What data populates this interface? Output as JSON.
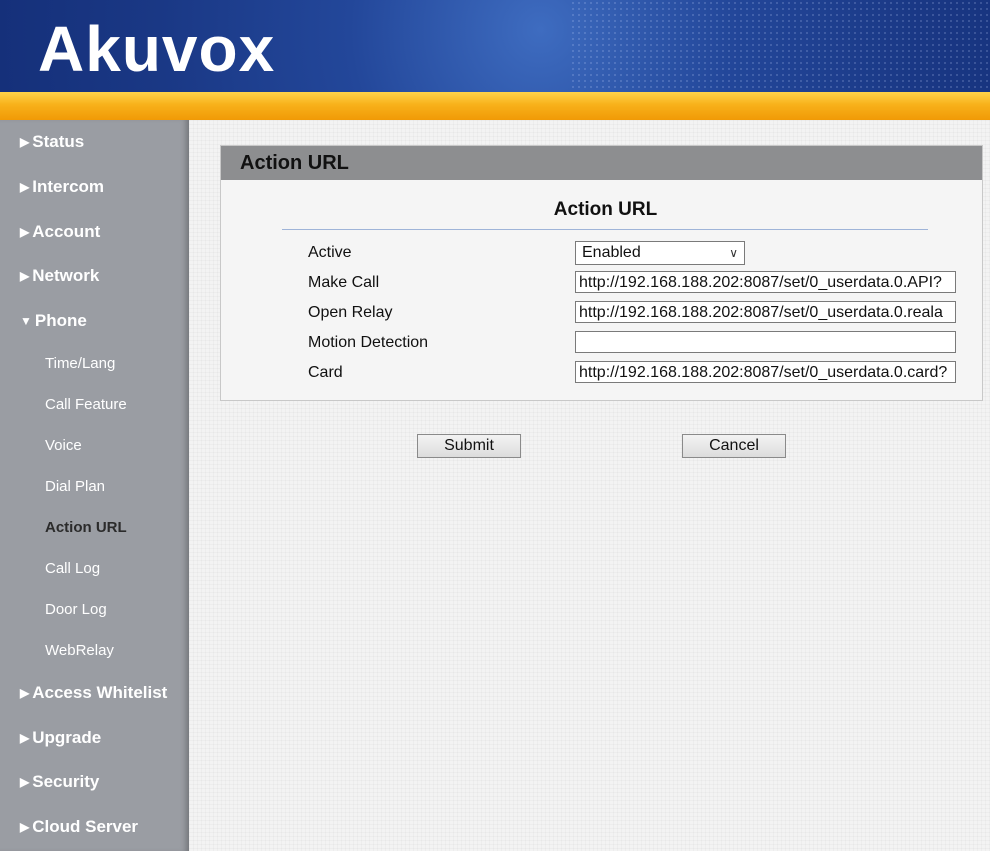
{
  "header": {
    "logo": "Akuvox"
  },
  "sidebar": {
    "top_items": [
      {
        "label": "Status",
        "arrow": "▶"
      },
      {
        "label": "Intercom",
        "arrow": "▶"
      },
      {
        "label": "Account",
        "arrow": "▶"
      },
      {
        "label": "Network",
        "arrow": "▶"
      },
      {
        "label": "Phone",
        "arrow": "▼"
      }
    ],
    "phone_sub_items": [
      {
        "label": "Time/Lang"
      },
      {
        "label": "Call Feature"
      },
      {
        "label": "Voice"
      },
      {
        "label": "Dial Plan"
      },
      {
        "label": "Action URL"
      },
      {
        "label": "Call Log"
      },
      {
        "label": "Door Log"
      },
      {
        "label": "WebRelay"
      }
    ],
    "bottom_items": [
      {
        "label": "Access Whitelist",
        "arrow": "▶"
      },
      {
        "label": "Upgrade",
        "arrow": "▶"
      },
      {
        "label": "Security",
        "arrow": "▶"
      },
      {
        "label": "Cloud Server",
        "arrow": "▶"
      }
    ]
  },
  "panel": {
    "title": "Action URL",
    "section_title": "Action URL",
    "fields": {
      "active": {
        "label": "Active",
        "value": "Enabled"
      },
      "make_call": {
        "label": "Make Call",
        "value": "http://192.168.188.202:8087/set/0_userdata.0.API?"
      },
      "open_relay": {
        "label": "Open Relay",
        "value": "http://192.168.188.202:8087/set/0_userdata.0.reala"
      },
      "motion_detection": {
        "label": "Motion Detection",
        "value": ""
      },
      "card": {
        "label": "Card",
        "value": "http://192.168.188.202:8087/set/0_userdata.0.card?"
      }
    }
  },
  "buttons": {
    "submit": "Submit",
    "cancel": "Cancel"
  }
}
